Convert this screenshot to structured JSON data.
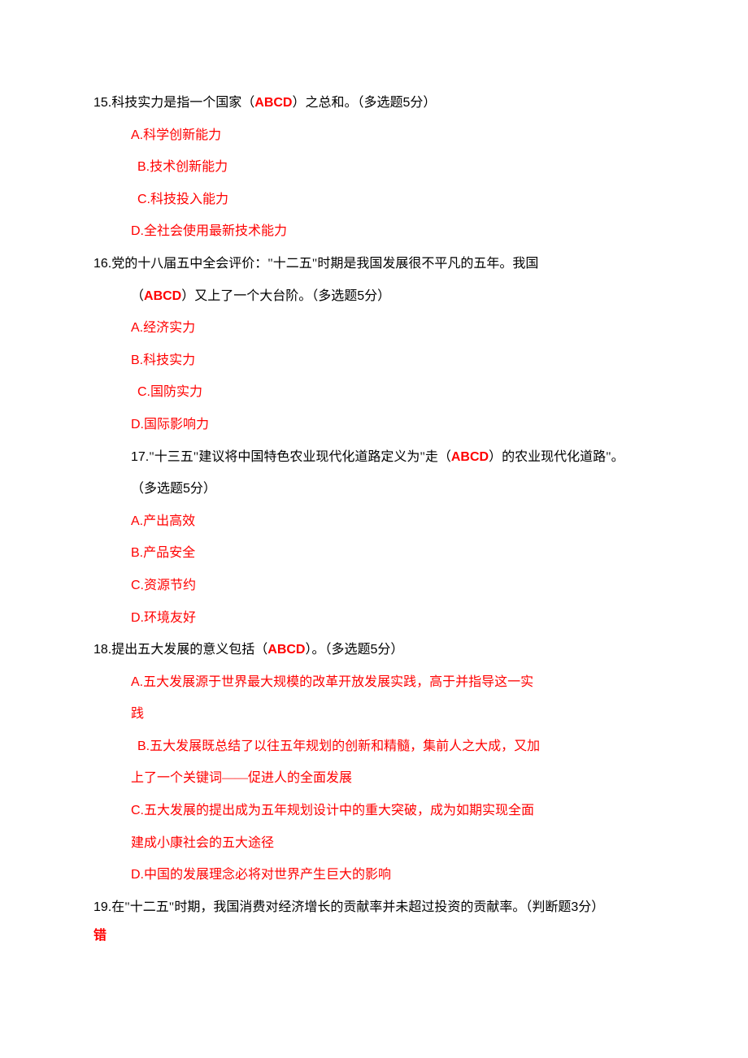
{
  "q15": {
    "number": "15.",
    "stem_before": "科技实力是指一个国家（",
    "answer": "ABCD",
    "stem_after": "）之总和。（多选题",
    "points_num": "5",
    "points_suffix": "分）",
    "options": {
      "A": {
        "letter": "A.",
        "text": "科学创新能力"
      },
      "B": {
        "letter": "B.",
        "text": "技术创新能力"
      },
      "C": {
        "letter": "C.",
        "text": "科技投入能力"
      },
      "D": {
        "letter": "D.",
        "text": "全社会使用最新技术能力"
      }
    }
  },
  "q16": {
    "number": "16.",
    "stem_line1": "党的十八届五中全会评价：\"十二五\"时期是我国发展很不平凡的五年。我国",
    "stem_before": "（",
    "answer": "ABCD",
    "stem_after": "）又上了一个大台阶。（多选题",
    "points_num": "5",
    "points_suffix": "分）",
    "options": {
      "A": {
        "letter": "A.",
        "text": "经济实力"
      },
      "B": {
        "letter": "B.",
        "text": "科技实力"
      },
      "C": {
        "letter": "C.",
        "text": "国防实力"
      },
      "D": {
        "letter": "D.",
        "text": "国际影响力"
      }
    }
  },
  "q17": {
    "number": "17.",
    "stem_before": "\"十三五\"建议将中国特色农业现代化道路定义为\"走（",
    "answer": "ABCD",
    "stem_after": "）的农业现代化道路\"。",
    "stem_line2_before": "（多选题",
    "points_num": "5",
    "points_suffix": "分）",
    "options": {
      "A": {
        "letter": "A.",
        "text": "产出高效"
      },
      "B": {
        "letter": "B.",
        "text": "产品安全"
      },
      "C": {
        "letter": "C.",
        "text": "资源节约"
      },
      "D": {
        "letter": "D.",
        "text": "环境友好"
      }
    }
  },
  "q18": {
    "number": "18.",
    "stem_before": "提出五大发展的意义包括（",
    "answer": "ABCD",
    "stem_after": "）。（多选题",
    "points_num": "5",
    "points_suffix": "分）",
    "options": {
      "A": {
        "letter": "A.",
        "line1": "五大发展源于世界最大规模的改革开放发展实践，高于并指导这一实",
        "line2": "践"
      },
      "B": {
        "letter": "B.",
        "line1": "五大发展既总结了以往五年规划的创新和精髓，集前人之大成，又加",
        "line2": "上了一个关键词——促进人的全面发展"
      },
      "C": {
        "letter": "C.",
        "line1": "五大发展的提出成为五年规划设计中的重大突破，成为如期实现全面",
        "line2": "建成小康社会的五大途径"
      },
      "D": {
        "letter": "D.",
        "text": "中国的发展理念必将对世界产生巨大的影响"
      }
    }
  },
  "q19": {
    "number": "19.",
    "stem_before": "在\"十二五\"时期，我国消费对经济增长的贡献率并未超过投资的贡献率。（判断题",
    "points_num": "3",
    "points_suffix": "分）",
    "answer": "错"
  }
}
